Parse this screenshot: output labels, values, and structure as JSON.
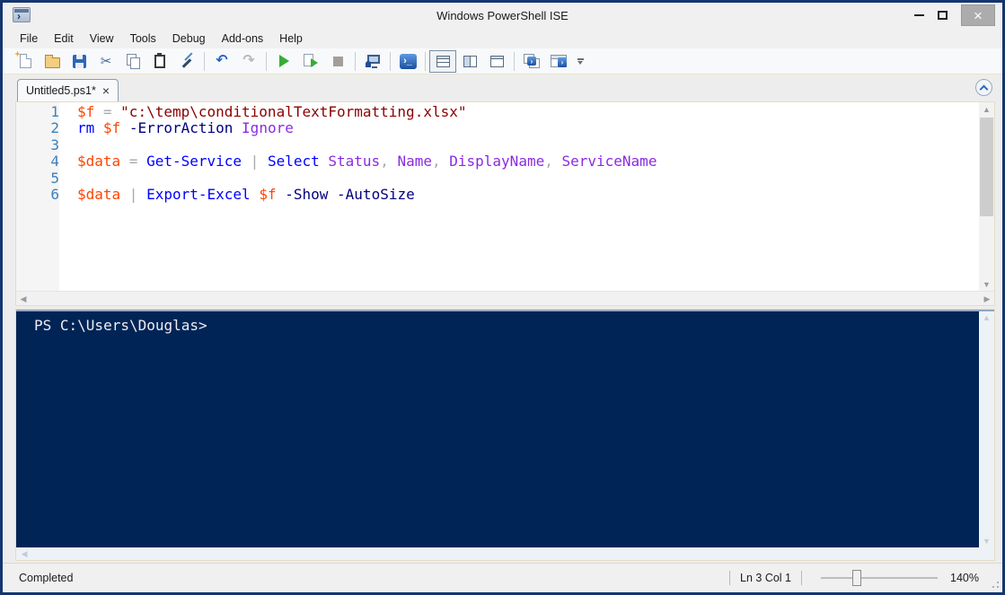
{
  "window": {
    "title": "Windows PowerShell ISE",
    "controls": {
      "minimize": "minimize",
      "maximize": "maximize",
      "close": "close",
      "close_glyph": "×"
    }
  },
  "menu": {
    "items": [
      "File",
      "Edit",
      "View",
      "Tools",
      "Debug",
      "Add-ons",
      "Help"
    ]
  },
  "toolbar": {
    "buttons": [
      "New",
      "Open",
      "Save",
      "Cut",
      "Copy",
      "Paste",
      "Clear Console Pane",
      "Undo",
      "Redo",
      "Run Script",
      "Run Selection",
      "Stop Operation",
      "New Remote PowerShell Tab",
      "Start PowerShell.exe",
      "Show Script Pane Top",
      "Show Script Pane Right",
      "Show Script Pane Maximized",
      "New PowerShell Tab",
      "Show PowerShell Console",
      "Toolbar Options"
    ],
    "cut_glyph": "✂",
    "undo_glyph": "↶",
    "redo_glyph": "↷",
    "ps_glyph": "›_"
  },
  "tab": {
    "label": "Untitled5.ps1*",
    "close_glyph": "×"
  },
  "editor": {
    "syntax_colors": {
      "variable": "#FF4500",
      "operator": "#A9A9A9",
      "string": "#8B0000",
      "command": "#0000FF",
      "parameter": "#000080",
      "argument": "#8A2BE2",
      "plain": "#000000"
    },
    "line_number_color": "#3F7FBE",
    "lines": [
      {
        "n": "1",
        "tokens": [
          {
            "t": "variable",
            "s": "$f"
          },
          {
            "t": "operator",
            "s": " = "
          },
          {
            "t": "string",
            "s": "\"c:\\temp\\conditionalTextFormatting.xlsx\""
          }
        ]
      },
      {
        "n": "2",
        "tokens": [
          {
            "t": "command",
            "s": "rm"
          },
          {
            "t": "plain",
            "s": " "
          },
          {
            "t": "variable",
            "s": "$f"
          },
          {
            "t": "plain",
            "s": " "
          },
          {
            "t": "parameter",
            "s": "-ErrorAction"
          },
          {
            "t": "plain",
            "s": " "
          },
          {
            "t": "argument",
            "s": "Ignore"
          }
        ]
      },
      {
        "n": "3",
        "tokens": []
      },
      {
        "n": "4",
        "tokens": [
          {
            "t": "variable",
            "s": "$data"
          },
          {
            "t": "operator",
            "s": " = "
          },
          {
            "t": "command",
            "s": "Get-Service"
          },
          {
            "t": "operator",
            "s": " | "
          },
          {
            "t": "command",
            "s": "Select"
          },
          {
            "t": "plain",
            "s": " "
          },
          {
            "t": "argument",
            "s": "Status"
          },
          {
            "t": "operator",
            "s": ", "
          },
          {
            "t": "argument",
            "s": "Name"
          },
          {
            "t": "operator",
            "s": ", "
          },
          {
            "t": "argument",
            "s": "DisplayName"
          },
          {
            "t": "operator",
            "s": ", "
          },
          {
            "t": "argument",
            "s": "ServiceName"
          }
        ]
      },
      {
        "n": "5",
        "tokens": []
      },
      {
        "n": "6",
        "tokens": [
          {
            "t": "variable",
            "s": "$data"
          },
          {
            "t": "operator",
            "s": " | "
          },
          {
            "t": "command",
            "s": "Export-Excel"
          },
          {
            "t": "plain",
            "s": " "
          },
          {
            "t": "variable",
            "s": "$f"
          },
          {
            "t": "plain",
            "s": " "
          },
          {
            "t": "parameter",
            "s": "-Show"
          },
          {
            "t": "plain",
            "s": " "
          },
          {
            "t": "parameter",
            "s": "-AutoSize"
          }
        ]
      }
    ]
  },
  "console": {
    "prompt": "PS C:\\Users\\Douglas>",
    "background": "#012456",
    "text_color": "#EEEDF0"
  },
  "status": {
    "state": "Completed",
    "position": "Ln 3 Col 1",
    "zoom_percent": "140%"
  }
}
